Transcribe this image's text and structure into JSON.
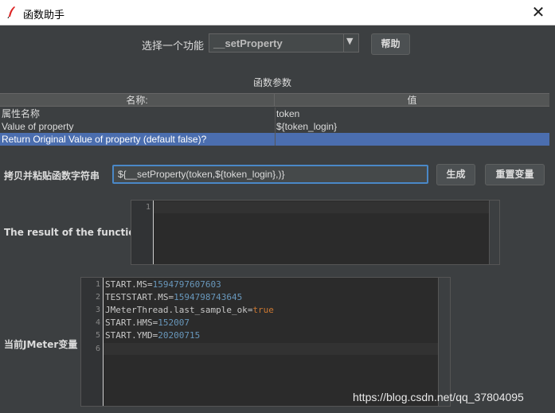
{
  "window": {
    "title": "函数助手",
    "close_glyph": "✕",
    "icon": "jmeter-feather-icon"
  },
  "function_select": {
    "label": "选择一个功能",
    "selected": "__setProperty",
    "arrow": "▼"
  },
  "help_button": "帮助",
  "params": {
    "section_title": "函数参数",
    "headers": [
      "名称:",
      "值"
    ],
    "rows": [
      {
        "name": "属性名称",
        "value": "token"
      },
      {
        "name": "Value of property",
        "value": "${token_login}"
      },
      {
        "name": "Return Original Value of property (default false)?",
        "value": ""
      }
    ]
  },
  "copy_string": {
    "label": "拷贝并粘贴函数字符串",
    "value": "${__setProperty(token,${token_login},)}",
    "generate_button": "生成",
    "reset_button": "重置变量"
  },
  "result": {
    "label": "The result of the function is",
    "lines": [
      "1"
    ]
  },
  "vars": {
    "label": "当前JMeter变量",
    "lines": [
      {
        "n": "1",
        "key": "START.MS",
        "value": "1594797607603",
        "kind": "num"
      },
      {
        "n": "2",
        "key": "TESTSTART.MS",
        "value": "1594798743645",
        "kind": "num"
      },
      {
        "n": "3",
        "key": "JMeterThread.last_sample_ok",
        "value": "true",
        "kind": "kw"
      },
      {
        "n": "4",
        "key": "START.HMS",
        "value": "152007",
        "kind": "num"
      },
      {
        "n": "5",
        "key": "START.YMD",
        "value": "20200715",
        "kind": "num"
      },
      {
        "n": "6",
        "key": "",
        "value": "",
        "kind": ""
      }
    ]
  },
  "watermark": "https://blog.csdn.net/qq_37804095",
  "colors": {
    "background": "#3c3f41",
    "selection": "#4b6eaf",
    "number": "#6897bb",
    "keyword": "#cc7832"
  }
}
